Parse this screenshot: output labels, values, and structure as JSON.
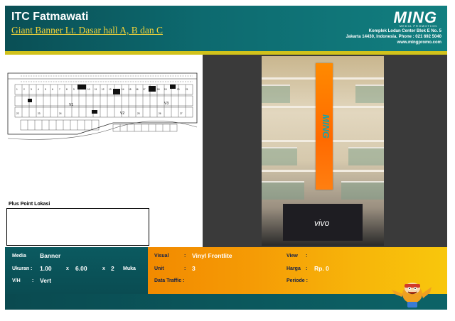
{
  "header": {
    "title": "ITC Fatmawati",
    "subtitle": "Giant Banner Lt. Dasar hall A, B dan C",
    "brand": "MING",
    "brand_sub": "MEDIA PROMOTION",
    "address_line1": "Komplek Lodan Center Blok E No. 5",
    "address_line2": "Jakarta 14430, Indonesia. Phone : 021 692 5040",
    "address_line3": "www.mingpromo.com"
  },
  "map": {
    "labels": [
      "V1",
      "V2",
      "V3"
    ],
    "numbers": [
      "1",
      "2",
      "3",
      "4",
      "5",
      "6",
      "7",
      "8",
      "9",
      "10",
      "11",
      "12",
      "13",
      "14",
      "15",
      "16",
      "17",
      "18",
      "19",
      "20",
      "21",
      "22",
      "23",
      "24",
      "25",
      "26",
      "27"
    ]
  },
  "plus_point": {
    "label": "Plus Point Lokasi",
    "text": ""
  },
  "photo": {
    "banner_text": "MING",
    "shop_sign": "vivo"
  },
  "specs": {
    "media_label": "Media",
    "media_value": "Banner",
    "ukuran_label": "Ukuran :",
    "width": "1.00",
    "x1": "x",
    "height": "6.00",
    "x2": "x",
    "faces": "2",
    "faces_label": "Muka",
    "vh_label": "V/H",
    "vh_value": "Vert",
    "visual_label": "Visual",
    "visual_value": "Vinyl Frontlite",
    "unit_label": "Unit",
    "unit_value": "3",
    "traffic_label": "Data Traffic :",
    "view_label": "View",
    "view_value": "",
    "harga_label": "Harga",
    "harga_value": "Rp. 0",
    "periode_label": "Periode :",
    "colon": ":"
  },
  "colors": {
    "teal": "#0b5a60",
    "orange": "#f28a00",
    "yellow": "#f8c70c",
    "accent_yellow": "#d1c21b"
  }
}
